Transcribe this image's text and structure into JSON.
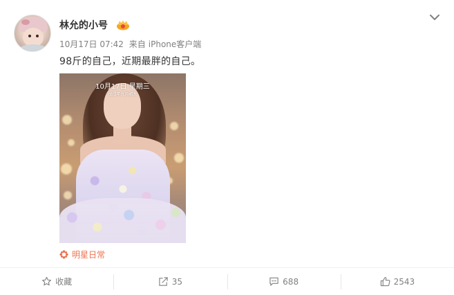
{
  "post": {
    "username": "林允的小号",
    "date": "10月17日 07:42",
    "source_prefix": "来自",
    "source": "iPhone客户端",
    "text": "98斤的自己，近期最胖的自己。",
    "photo": {
      "overlay_date": "10月17日 星期三",
      "overlay_lunar": "戊戌年九月初九"
    },
    "topic": "明星日常"
  },
  "actions": {
    "favorite_label": "收藏",
    "repost_count": "35",
    "comment_count": "688",
    "like_count": "2543"
  },
  "icons": {
    "badge": "vip-crown-icon",
    "menu": "chevron-down-icon",
    "topic": "topic-flower-icon",
    "favorite": "star-icon",
    "repost": "repost-icon",
    "comment": "comment-icon",
    "like": "thumbs-up-icon"
  },
  "colors": {
    "accent": "#eb7350",
    "text": "#333333",
    "meta": "#808080"
  }
}
